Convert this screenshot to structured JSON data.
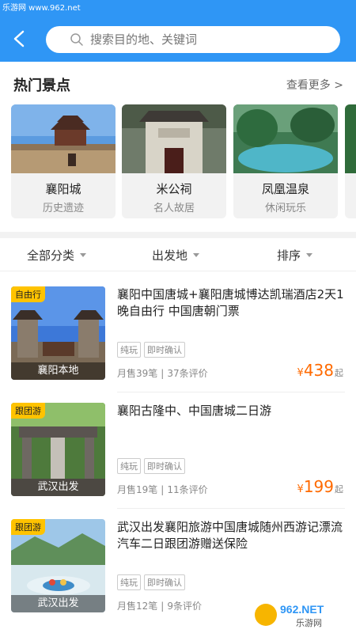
{
  "watermark_top": "乐游网 www.962.net",
  "search": {
    "placeholder": "搜索目的地、关键词"
  },
  "hot": {
    "title": "热门景点",
    "more": "查看更多 >",
    "spots": [
      {
        "name": "襄阳城",
        "sub": "历史遗迹"
      },
      {
        "name": "米公祠",
        "sub": "名人故居"
      },
      {
        "name": "凤凰温泉",
        "sub": "休闲玩乐"
      }
    ]
  },
  "filters": [
    "全部分类",
    "出发地",
    "排序"
  ],
  "products": [
    {
      "badge": "自由行",
      "caption": "襄阳本地",
      "title": "襄阳中国唐城+襄阳唐城博达凯瑞酒店2天1晚自由行 中国唐朝门票",
      "tags": [
        "纯玩",
        "即时确认"
      ],
      "sales": "月售39笔",
      "reviews": "37条评价",
      "price_symbol": "¥",
      "price": "438",
      "price_suffix": "起"
    },
    {
      "badge": "跟团游",
      "caption": "武汉出发",
      "title": "襄阳古隆中、中国唐城二日游",
      "tags": [
        "纯玩",
        "即时确认"
      ],
      "sales": "月售19笔",
      "reviews": "11条评价",
      "price_symbol": "¥",
      "price": "199",
      "price_suffix": "起"
    },
    {
      "badge": "跟团游",
      "caption": "武汉出发",
      "title": "武汉出发襄阳旅游中国唐城随州西游记漂流汽车二日跟团游赠送保险",
      "tags": [
        "纯玩",
        "即时确认"
      ],
      "sales": "月售12笔",
      "reviews": "9条评价"
    }
  ],
  "meta_separator": "|",
  "watermark_logo": {
    "brand": "962.NET",
    "sub": "乐游网"
  },
  "colors": {
    "header": "#2f96f5",
    "price": "#ff6a00",
    "badge": "#ffc300"
  }
}
